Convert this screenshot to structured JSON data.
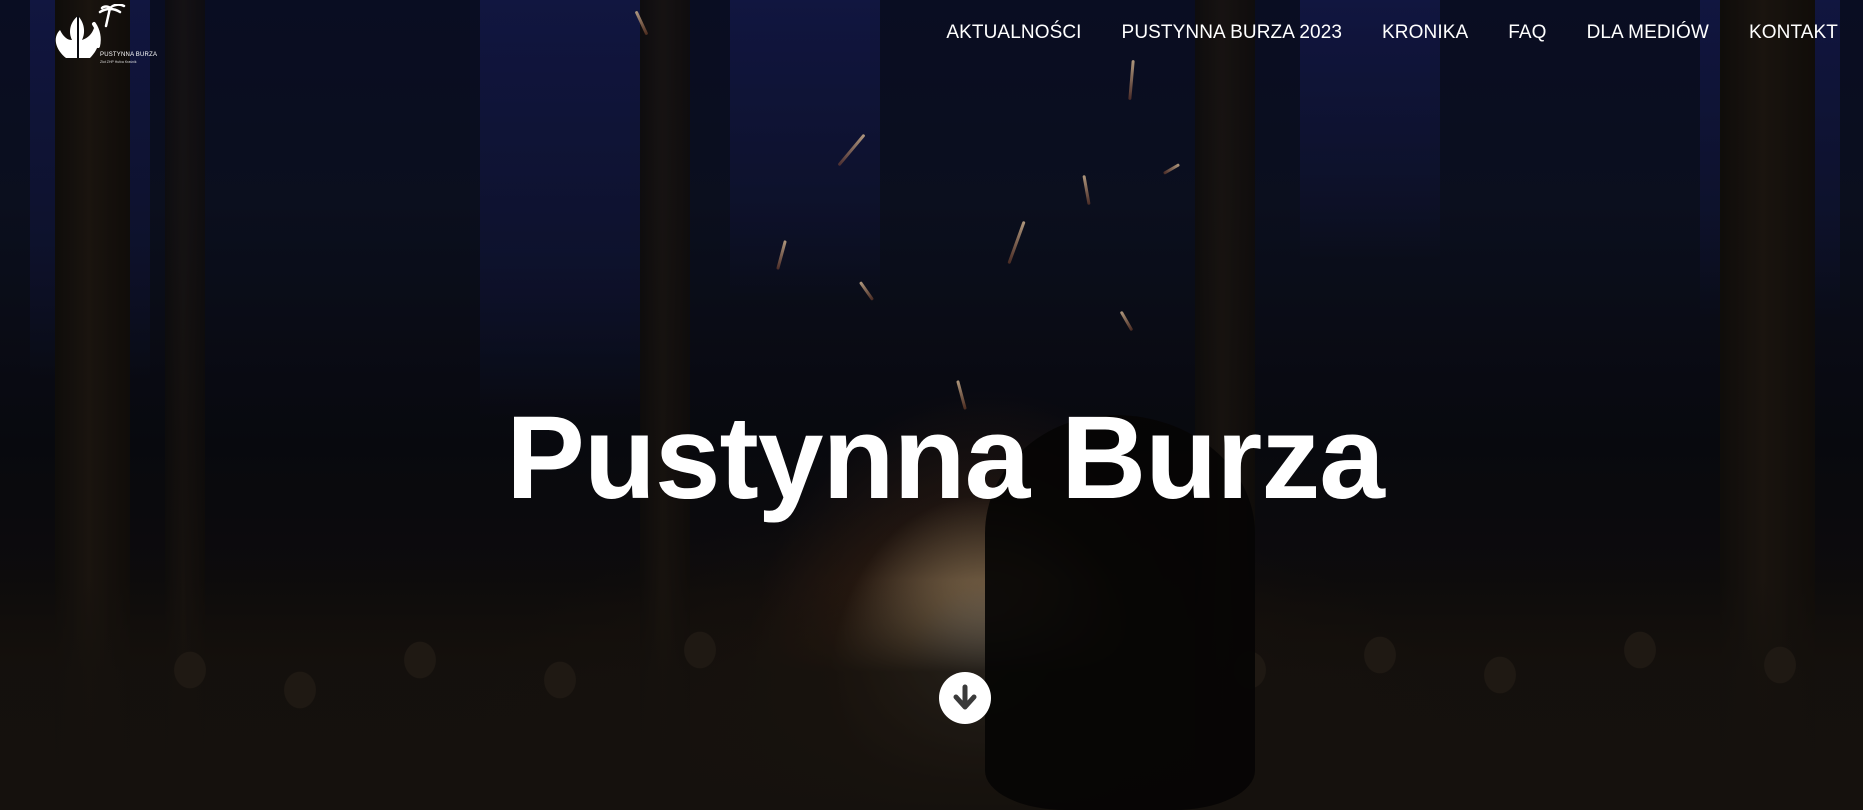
{
  "brand": {
    "logo_text": "PUSTYNNA BURZA",
    "logo_subtext": "Zlot ZHP Hufca Kraśnik",
    "logo_icon": "fleur-de-lis-palm-icon"
  },
  "nav": {
    "items": [
      {
        "label": "AKTUALNOŚCI"
      },
      {
        "label": "PUSTYNNA BURZA 2023"
      },
      {
        "label": "KRONIKA"
      },
      {
        "label": "FAQ"
      },
      {
        "label": "DLA MEDIÓW"
      },
      {
        "label": "KONTAKT"
      }
    ]
  },
  "hero": {
    "title": "Pustynna Burza",
    "scroll_icon": "arrow-down-icon"
  },
  "colors": {
    "text": "#ffffff",
    "background": "#0a0b10",
    "fire": "#ffd9a0"
  }
}
